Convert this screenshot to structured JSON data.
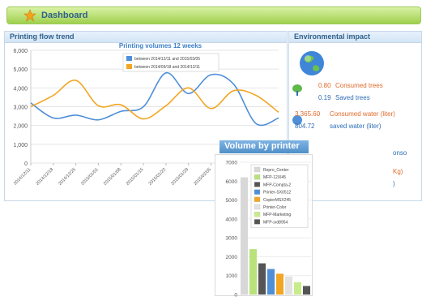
{
  "header": {
    "title": "Dashboard"
  },
  "flow_panel": {
    "title": "Printing flow trend",
    "chart_title": "Printing volumes 12 weeks",
    "legend": [
      {
        "label": "between 2014/12/11 and 2015/03/05",
        "color": "#4f8fd8"
      },
      {
        "label": "between 2014/09/18 and 2014/12/11",
        "color": "#f2a623"
      }
    ]
  },
  "env_panel": {
    "title": "Environmental impact",
    "rows": [
      {
        "value": "0.80",
        "label": "Consumed trees",
        "color": "#e06a2a"
      },
      {
        "value": "0.19",
        "label": "Saved trees",
        "color": "#2f6db5"
      },
      {
        "value": "3,365.60",
        "label": "Consumed water (liter)",
        "color": "#e06a2a"
      },
      {
        "value": "804.72",
        "label": "saved water (liter)",
        "color": "#2f6db5"
      }
    ],
    "partial": [
      "onso",
      "Kg)",
      ")"
    ]
  },
  "printer_panel": {
    "title": "Volume by printer"
  },
  "chart_data": [
    {
      "type": "line",
      "title": "Printing volumes 12 weeks",
      "x": [
        "2014/12/11",
        "2014/12/18",
        "2014/12/25",
        "2015/01/01",
        "2015/01/08",
        "2015/01/15",
        "2015/01/22",
        "2015/01/29",
        "2015/02/05",
        "2015/02/12",
        "2015/02/19",
        "2015/02/26"
      ],
      "y_ticks": [
        "0",
        "1,000",
        "2,000",
        "3,000",
        "4,000",
        "5,000",
        "6,000"
      ],
      "ylim": [
        0,
        6000
      ],
      "series": [
        {
          "name": "between 2014/12/11 and 2015/03/05",
          "color": "#4f8fd8",
          "values": [
            3200,
            2400,
            2550,
            2300,
            2750,
            3000,
            4800,
            3700,
            4700,
            4200,
            2100,
            2400
          ]
        },
        {
          "name": "between 2014/09/18 and 2014/12/11",
          "color": "#f2a623",
          "values": [
            3000,
            3600,
            4400,
            3050,
            3100,
            2350,
            3050,
            4000,
            2900,
            3850,
            3600,
            2700
          ]
        }
      ]
    },
    {
      "type": "bar",
      "title": "Volume by printer",
      "categories": [
        "Repro_Center",
        "MFP-12XI45",
        "MFP-Compta-2",
        "Printer-SX0512",
        "CopierMSX245",
        "Printer-Color",
        "MFP-Marketing",
        "MFP-srd8954"
      ],
      "values": [
        6200,
        2400,
        1650,
        1350,
        1100,
        950,
        650,
        450
      ],
      "colors": [
        "#d8d8d8",
        "#b9e27a",
        "#555555",
        "#4f8fd8",
        "#f2a623",
        "#e2e2e2",
        "#c8ec8a",
        "#555555"
      ],
      "y_ticks": [
        "0",
        "1000",
        "2000",
        "3000",
        "4000",
        "5000",
        "6000",
        "7000"
      ],
      "ylim": [
        0,
        7000
      ]
    }
  ]
}
